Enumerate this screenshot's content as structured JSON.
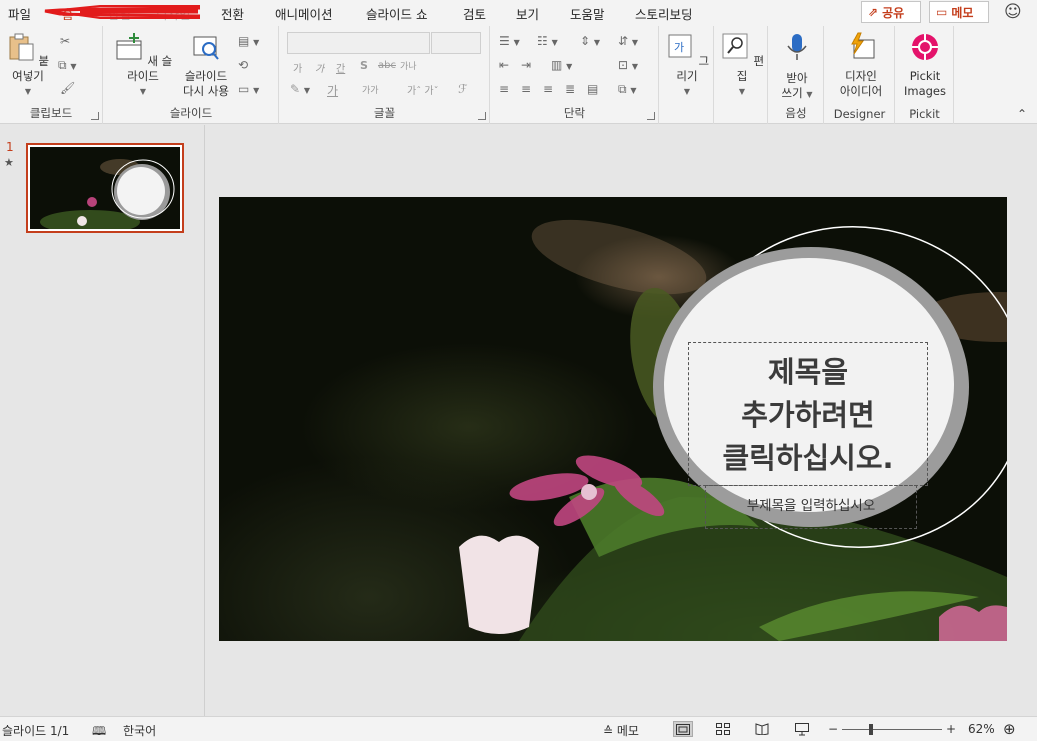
{
  "menu": {
    "tabs": [
      "파일",
      "홈",
      "삽입",
      "디자인",
      "전환",
      "애니메이션",
      "슬라이드 쇼",
      "검토",
      "보기",
      "도움말",
      "스토리보딩"
    ],
    "share_label": "공유",
    "comment_label": "메모"
  },
  "ribbon": {
    "clipboard": {
      "paste_label": "붙여넣기",
      "group_label": "클립보드"
    },
    "slides": {
      "new_slide_label": "새 슬라이드",
      "reuse_line1": "슬라이드",
      "reuse_line2": "다시 사용",
      "group_label": "슬라이드"
    },
    "font": {
      "group_label": "글꼴",
      "row2": [
        "가",
        "가",
        "간",
        "S",
        "가나"
      ],
      "row3_sizes": [
        "가가",
        "가",
        "가"
      ]
    },
    "paragraph": {
      "group_label": "단락"
    },
    "drawing": {
      "draw_label": "그리기"
    },
    "editing": {
      "edit_label": "편집"
    },
    "voice": {
      "dictate_line1": "받아",
      "dictate_line2": "쓰기",
      "group_label": "음성"
    },
    "designer": {
      "ideas_line1": "디자인",
      "ideas_line2": "아이디어",
      "group_label": "Designer"
    },
    "pickit": {
      "label_line1": "Pickit",
      "label_line2": "Images",
      "group_label": "Pickit"
    }
  },
  "slide_pane": {
    "slide_number": "1",
    "star": "★"
  },
  "slide": {
    "title_lines": [
      "제목을",
      "추가하려면",
      "클릭하십시오."
    ],
    "subtitle": "부제목을 입력하십시오"
  },
  "status": {
    "slide_info": "슬라이드 1/1",
    "language": "한국어",
    "notes_label": "메모",
    "zoom_minus": "−",
    "zoom_plus": "+",
    "zoom_level": "62%",
    "zoom_fraction": 0.62
  },
  "colors": {
    "accent": "#c43e1c",
    "pickit": "#e4136b",
    "designer": "#f0a30a",
    "dictate": "#2b6cc4"
  }
}
